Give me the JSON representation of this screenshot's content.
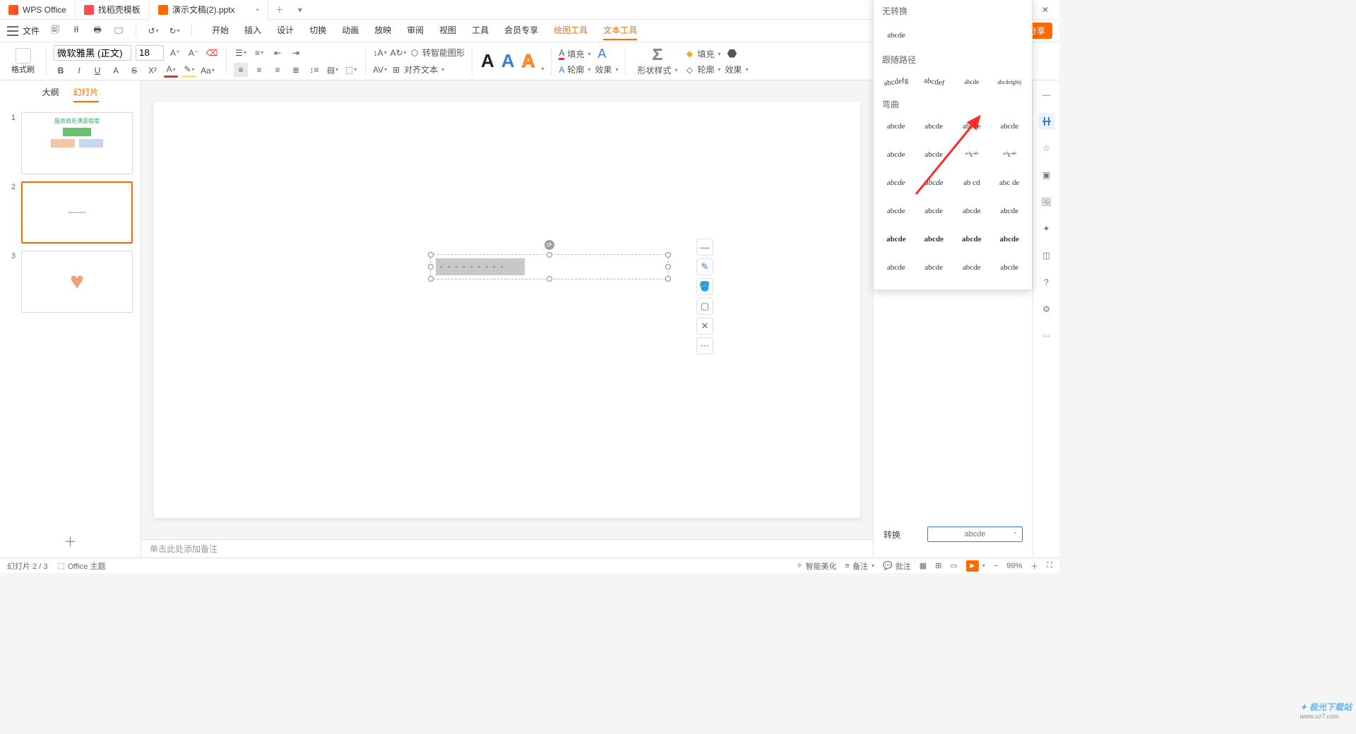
{
  "titlebar": {
    "tabs": [
      {
        "label": "WPS Office",
        "icon": "wps"
      },
      {
        "label": "找稻壳模板",
        "icon": "template"
      },
      {
        "label": "演示文稿(2).pptx",
        "icon": "ppt",
        "active": true,
        "dirty": true
      }
    ]
  },
  "menubar": {
    "file": "文件",
    "tabs": [
      "开始",
      "插入",
      "设计",
      "切换",
      "动画",
      "放映",
      "审阅",
      "视图",
      "工具",
      "会员专享",
      "绘图工具",
      "文本工具"
    ],
    "accent_indices": [
      10,
      11
    ],
    "active_index": 11,
    "share": "分享"
  },
  "ribbon": {
    "format_brush": "格式刷",
    "font_name": "微软雅黑 (正文)",
    "font_size": "18",
    "smart_graphic": "转智能图形",
    "align_text": "对齐文本",
    "fill": "填充",
    "outline": "轮廓",
    "effects": "效果",
    "shape_style": "形状样式",
    "fill2": "填充",
    "outline2": "轮廓",
    "effects2": "效果"
  },
  "slide_panel": {
    "tabs": [
      "大纲",
      "幻灯片"
    ],
    "active_tab": 1,
    "slides": [
      {
        "num": "1",
        "kind": "diagram",
        "title_text": "服务政处满意程度"
      },
      {
        "num": "2",
        "kind": "line",
        "selected": true
      },
      {
        "num": "3",
        "kind": "heart"
      }
    ]
  },
  "canvas": {
    "textbox_value": "- - - - - - - - -"
  },
  "notes": {
    "placeholder": "单击此处添加备注"
  },
  "right_dock": {
    "transform_label": "转换",
    "select_value": "abcde"
  },
  "transform_popup": {
    "no_transform": "无转换",
    "sample": "abcde",
    "follow_path": "跟随路径",
    "bend": "弯曲",
    "path_variants": [
      "abcdefg",
      "abcdef",
      "abcde",
      "abcdefghij"
    ],
    "bend_rows": [
      [
        "abcde",
        "abcde",
        "abcde",
        "abcde"
      ],
      [
        "abcde",
        "abcde",
        "ᵃᵇcᵈᵉ",
        "ᵃᵇcᵈᵉ"
      ],
      [
        "abcde",
        "abcde",
        "ab cd",
        "abc de"
      ],
      [
        "abcde",
        "abcde",
        "abcde",
        "abcde"
      ],
      [
        "abcde",
        "abcde",
        "abcde",
        "abcde"
      ],
      [
        "abcde",
        "abcde",
        "abcde",
        "abcde"
      ]
    ]
  },
  "statusbar": {
    "slide_indicator": "幻灯片 2 / 3",
    "theme": "Office 主题",
    "beautify": "智能美化",
    "notes_btn": "备注",
    "comments_btn": "批注",
    "zoom": "99%"
  },
  "watermark": {
    "line1": "极光下载站",
    "line2": "www.xz7.com"
  }
}
